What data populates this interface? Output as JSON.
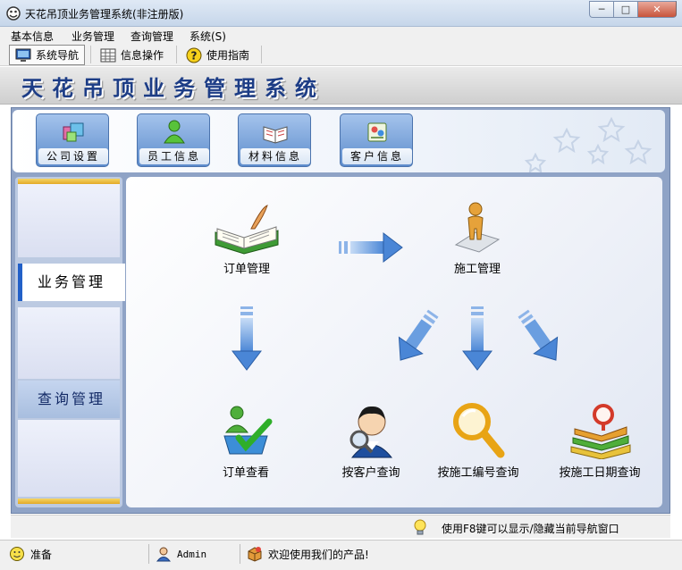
{
  "window": {
    "title": "天花吊顶业务管理系统(非注册版)",
    "controls": {
      "minimize": "─",
      "maximize": "□",
      "close": "✕"
    }
  },
  "menu": [
    "基本信息",
    "业务管理",
    "查询管理",
    "系统(S)"
  ],
  "toolbar": [
    {
      "label": "系统导航",
      "icon": "monitor-icon",
      "active": true
    },
    {
      "label": "信息操作",
      "icon": "grid-icon",
      "active": false
    },
    {
      "label": "使用指南",
      "icon": "help-icon",
      "active": false
    }
  ],
  "banner": {
    "title": "天花吊顶业务管理系统"
  },
  "quick_buttons": [
    {
      "label": "公司设置",
      "icon": "company-settings-icon"
    },
    {
      "label": "员工信息",
      "icon": "employee-icon"
    },
    {
      "label": "材料信息",
      "icon": "material-book-icon"
    },
    {
      "label": "客户信息",
      "icon": "customer-icon"
    }
  ],
  "sidebar": {
    "tabs": [
      {
        "label": "业务管理",
        "selected": true
      },
      {
        "label": "查询管理",
        "selected": false
      }
    ]
  },
  "workflow": {
    "order_management": "订单管理",
    "construction_management": "施工管理",
    "order_query": "订单查看",
    "query_by_customer": "按客户查询",
    "query_by_construction_number": "按施工编号查询",
    "query_by_construction_date": "按施工日期查询"
  },
  "hint": {
    "text": "使用F8键可以显示/隐藏当前导航窗口"
  },
  "status": {
    "state": "准备",
    "user": "Admin",
    "welcome": "欢迎使用我们的产品!"
  },
  "colors": {
    "banner_text": "#1d3d86",
    "frame": "#8fa3c6",
    "arrow": "#4a86d6",
    "selected_tab_border": "#2260c8"
  }
}
